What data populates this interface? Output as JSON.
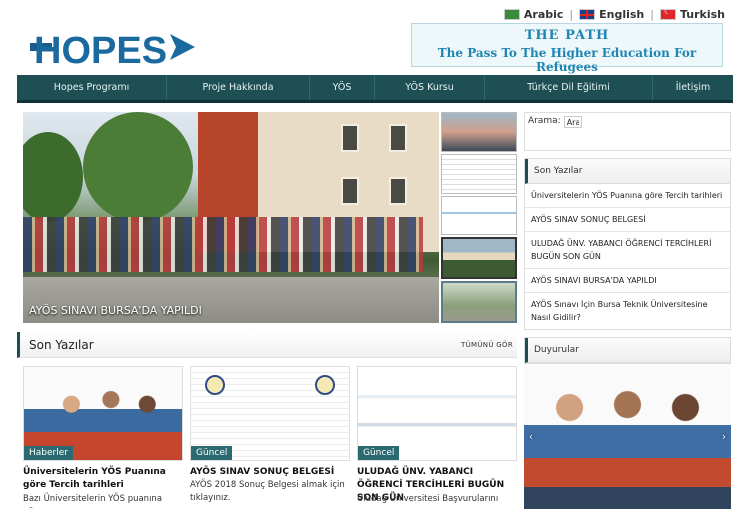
{
  "languages": [
    {
      "label": "Arabic"
    },
    {
      "label": "English"
    },
    {
      "label": "Turkish"
    }
  ],
  "brand": {
    "logo_text": "HOPES",
    "tagline_title": "THE PATH",
    "tagline_sub": "The Pass To The Higher Education For Refugees"
  },
  "colors": {
    "nav_bg": "#1d4f55",
    "accent": "#1e86b3",
    "badge_bg": "#2a6a70"
  },
  "nav": [
    {
      "label": "Hopes Programı"
    },
    {
      "label": "Proje Hakkında"
    },
    {
      "label": "YÖS"
    },
    {
      "label": "YÖS Kursu"
    },
    {
      "label": "Türkçe Dil Eğitimi"
    },
    {
      "label": "İletişim"
    }
  ],
  "slider": {
    "caption": "AYÖS SINAVI BURSA'DA YAPILDI"
  },
  "search": {
    "label": "Arama:",
    "value": "Ara"
  },
  "sidebar": {
    "recent_title": "Son Yazılar",
    "recent_items": [
      "Üniversitelerin YÖS Puanına göre Tercih tarihleri",
      "AYÖS SINAV SONUÇ BELGESİ",
      "ULUDAĞ ÜNV. YABANCI ÖĞRENCİ TERCİHLERİ BUGÜN SON GÜN",
      "AYÖS SINAVI BURSA'DA YAPILDI",
      "AYÖS Sınavı İçin Bursa Teknik Üniversitesine Nasıl Gidilir?"
    ],
    "announcements_title": "Duyurular"
  },
  "section": {
    "title": "Son Yazılar",
    "see_all": "TÜMÜNÜ GÖR"
  },
  "cards": [
    {
      "badge": "Haberler",
      "title": "Üniversitelerin YÖS Puanına göre Tercih tarihleri",
      "excerpt": "Bazı Üniversitelerin YÖS puanına göre"
    },
    {
      "badge": "Güncel",
      "title": "AYÖS SINAV SONUÇ BELGESİ",
      "excerpt": "AYÖS 2018 Sonuç Belgesi almak için tıklayınız."
    },
    {
      "badge": "Güncel",
      "title": "ULUDAĞ ÜNV. YABANCI ÖĞRENCİ TERCİHLERİ BUGÜN SON GÜN",
      "excerpt": "Uludağ Üniversitesi Başvurularını"
    }
  ]
}
